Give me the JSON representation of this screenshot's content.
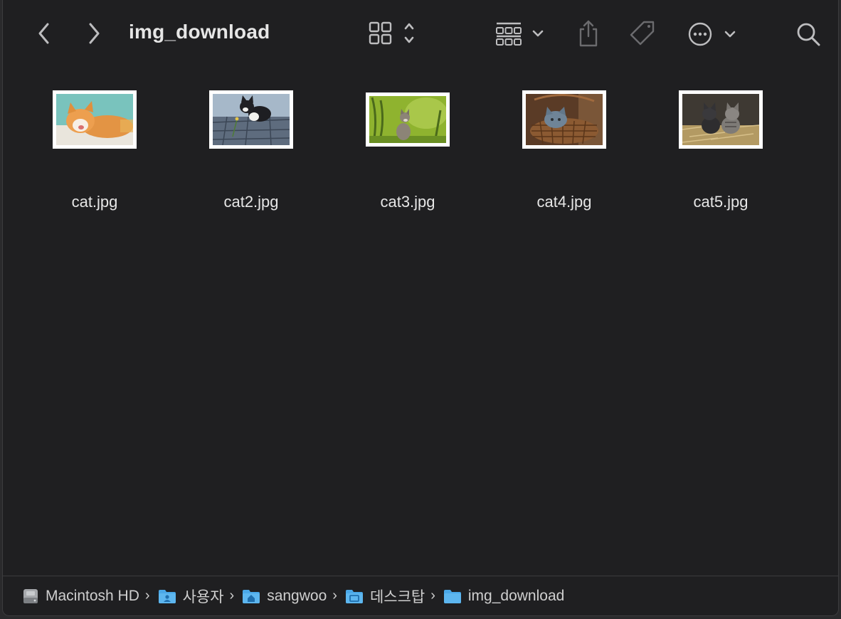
{
  "window": {
    "title": "img_download"
  },
  "toolbar": {
    "back_icon": "chevron-left-icon",
    "forward_icon": "chevron-right-icon",
    "view_icon": "icon-grid-view-icon",
    "group_icon": "group-by-icon",
    "share_icon": "share-icon",
    "tag_icon": "tag-icon",
    "more_icon": "ellipsis-circle-icon",
    "search_icon": "search-icon"
  },
  "files": [
    {
      "name": "cat.jpg",
      "thumb": "orange-white cat lying down"
    },
    {
      "name": "cat2.jpg",
      "thumb": "black-white kitten on cobblestones"
    },
    {
      "name": "cat3.jpg",
      "thumb": "grey kitten in green grass"
    },
    {
      "name": "cat4.jpg",
      "thumb": "grey kitten in wicker basket"
    },
    {
      "name": "cat5.jpg",
      "thumb": "two tabby kittens on straw"
    }
  ],
  "pathbar": {
    "crumbs": [
      {
        "label": "Macintosh HD",
        "icon": "hard-drive-icon"
      },
      {
        "label": "사용자",
        "icon": "users-folder-icon"
      },
      {
        "label": "sangwoo",
        "icon": "home-folder-icon"
      },
      {
        "label": "데스크탑",
        "icon": "desktop-folder-icon"
      },
      {
        "label": "img_download",
        "icon": "folder-icon"
      }
    ],
    "separator": "›"
  },
  "colors": {
    "window_bg": "#1f1f21",
    "text": "#e6e6e6",
    "icon": "#bdbdbf",
    "folder_blue": "#4aa8e8"
  }
}
